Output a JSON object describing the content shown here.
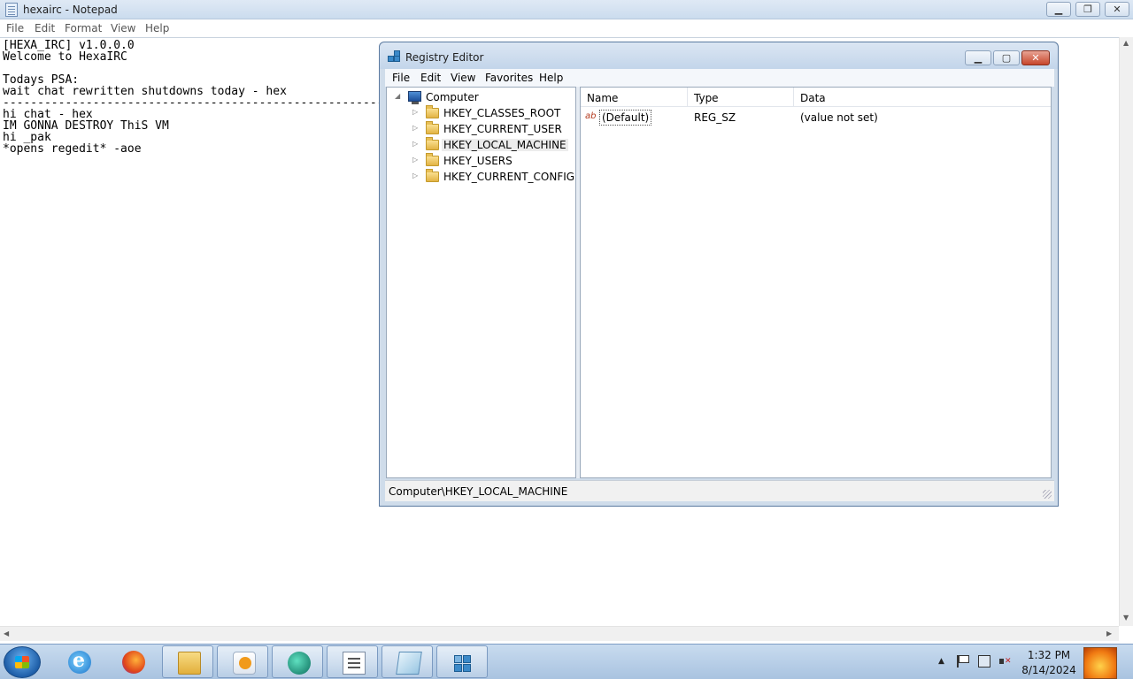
{
  "notepad": {
    "title": "hexairc - Notepad",
    "menu": [
      "File",
      "Edit",
      "Format",
      "View",
      "Help"
    ],
    "lines": [
      "[HEXA_IRC] v1.0.0.0",
      "Welcome to HexaIRC",
      "",
      "Todays PSA:",
      "wait chat rewritten shutdowns today - hex",
      "-----------------------------------------------------------",
      "hi chat - hex",
      "IM GONNA DESTROY ThiS VM",
      "hi _pak",
      "*opens regedit* -aoe"
    ]
  },
  "regedit": {
    "title": "Registry Editor",
    "menu": [
      "File",
      "Edit",
      "View",
      "Favorites",
      "Help"
    ],
    "tree": {
      "root": "Computer",
      "keys": [
        "HKEY_CLASSES_ROOT",
        "HKEY_CURRENT_USER",
        "HKEY_LOCAL_MACHINE",
        "HKEY_USERS",
        "HKEY_CURRENT_CONFIG"
      ],
      "selected": "HKEY_LOCAL_MACHINE"
    },
    "columns": [
      "Name",
      "Type",
      "Data"
    ],
    "values": [
      {
        "name": "(Default)",
        "type": "REG_SZ",
        "data": "(value not set)",
        "icon": "reg-sz-icon"
      }
    ],
    "status": "Computer\\HKEY_LOCAL_MACHINE"
  },
  "taskbar": {
    "pinned": [
      "internet-explorer-icon",
      "firefox-icon",
      "windows-explorer-icon",
      "media-player-icon",
      "chat-app-icon",
      "list-app-icon",
      "notepad-icon",
      "regedit-icon"
    ],
    "clock": {
      "time": "1:32 PM",
      "date": "8/14/2024"
    }
  }
}
